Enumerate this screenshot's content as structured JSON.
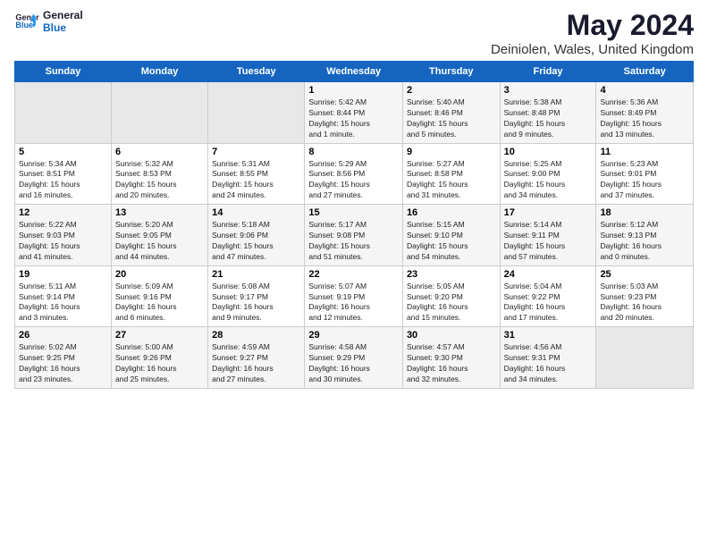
{
  "logo": {
    "line1": "General",
    "line2": "Blue"
  },
  "title": "May 2024",
  "subtitle": "Deiniolen, Wales, United Kingdom",
  "days_of_week": [
    "Sunday",
    "Monday",
    "Tuesday",
    "Wednesday",
    "Thursday",
    "Friday",
    "Saturday"
  ],
  "weeks": [
    [
      {
        "day": "",
        "info": ""
      },
      {
        "day": "",
        "info": ""
      },
      {
        "day": "",
        "info": ""
      },
      {
        "day": "1",
        "info": "Sunrise: 5:42 AM\nSunset: 8:44 PM\nDaylight: 15 hours\nand 1 minute."
      },
      {
        "day": "2",
        "info": "Sunrise: 5:40 AM\nSunset: 8:46 PM\nDaylight: 15 hours\nand 5 minutes."
      },
      {
        "day": "3",
        "info": "Sunrise: 5:38 AM\nSunset: 8:48 PM\nDaylight: 15 hours\nand 9 minutes."
      },
      {
        "day": "4",
        "info": "Sunrise: 5:36 AM\nSunset: 8:49 PM\nDaylight: 15 hours\nand 13 minutes."
      }
    ],
    [
      {
        "day": "5",
        "info": "Sunrise: 5:34 AM\nSunset: 8:51 PM\nDaylight: 15 hours\nand 16 minutes."
      },
      {
        "day": "6",
        "info": "Sunrise: 5:32 AM\nSunset: 8:53 PM\nDaylight: 15 hours\nand 20 minutes."
      },
      {
        "day": "7",
        "info": "Sunrise: 5:31 AM\nSunset: 8:55 PM\nDaylight: 15 hours\nand 24 minutes."
      },
      {
        "day": "8",
        "info": "Sunrise: 5:29 AM\nSunset: 8:56 PM\nDaylight: 15 hours\nand 27 minutes."
      },
      {
        "day": "9",
        "info": "Sunrise: 5:27 AM\nSunset: 8:58 PM\nDaylight: 15 hours\nand 31 minutes."
      },
      {
        "day": "10",
        "info": "Sunrise: 5:25 AM\nSunset: 9:00 PM\nDaylight: 15 hours\nand 34 minutes."
      },
      {
        "day": "11",
        "info": "Sunrise: 5:23 AM\nSunset: 9:01 PM\nDaylight: 15 hours\nand 37 minutes."
      }
    ],
    [
      {
        "day": "12",
        "info": "Sunrise: 5:22 AM\nSunset: 9:03 PM\nDaylight: 15 hours\nand 41 minutes."
      },
      {
        "day": "13",
        "info": "Sunrise: 5:20 AM\nSunset: 9:05 PM\nDaylight: 15 hours\nand 44 minutes."
      },
      {
        "day": "14",
        "info": "Sunrise: 5:18 AM\nSunset: 9:06 PM\nDaylight: 15 hours\nand 47 minutes."
      },
      {
        "day": "15",
        "info": "Sunrise: 5:17 AM\nSunset: 9:08 PM\nDaylight: 15 hours\nand 51 minutes."
      },
      {
        "day": "16",
        "info": "Sunrise: 5:15 AM\nSunset: 9:10 PM\nDaylight: 15 hours\nand 54 minutes."
      },
      {
        "day": "17",
        "info": "Sunrise: 5:14 AM\nSunset: 9:11 PM\nDaylight: 15 hours\nand 57 minutes."
      },
      {
        "day": "18",
        "info": "Sunrise: 5:12 AM\nSunset: 9:13 PM\nDaylight: 16 hours\nand 0 minutes."
      }
    ],
    [
      {
        "day": "19",
        "info": "Sunrise: 5:11 AM\nSunset: 9:14 PM\nDaylight: 16 hours\nand 3 minutes."
      },
      {
        "day": "20",
        "info": "Sunrise: 5:09 AM\nSunset: 9:16 PM\nDaylight: 16 hours\nand 6 minutes."
      },
      {
        "day": "21",
        "info": "Sunrise: 5:08 AM\nSunset: 9:17 PM\nDaylight: 16 hours\nand 9 minutes."
      },
      {
        "day": "22",
        "info": "Sunrise: 5:07 AM\nSunset: 9:19 PM\nDaylight: 16 hours\nand 12 minutes."
      },
      {
        "day": "23",
        "info": "Sunrise: 5:05 AM\nSunset: 9:20 PM\nDaylight: 16 hours\nand 15 minutes."
      },
      {
        "day": "24",
        "info": "Sunrise: 5:04 AM\nSunset: 9:22 PM\nDaylight: 16 hours\nand 17 minutes."
      },
      {
        "day": "25",
        "info": "Sunrise: 5:03 AM\nSunset: 9:23 PM\nDaylight: 16 hours\nand 20 minutes."
      }
    ],
    [
      {
        "day": "26",
        "info": "Sunrise: 5:02 AM\nSunset: 9:25 PM\nDaylight: 16 hours\nand 23 minutes."
      },
      {
        "day": "27",
        "info": "Sunrise: 5:00 AM\nSunset: 9:26 PM\nDaylight: 16 hours\nand 25 minutes."
      },
      {
        "day": "28",
        "info": "Sunrise: 4:59 AM\nSunset: 9:27 PM\nDaylight: 16 hours\nand 27 minutes."
      },
      {
        "day": "29",
        "info": "Sunrise: 4:58 AM\nSunset: 9:29 PM\nDaylight: 16 hours\nand 30 minutes."
      },
      {
        "day": "30",
        "info": "Sunrise: 4:57 AM\nSunset: 9:30 PM\nDaylight: 16 hours\nand 32 minutes."
      },
      {
        "day": "31",
        "info": "Sunrise: 4:56 AM\nSunset: 9:31 PM\nDaylight: 16 hours\nand 34 minutes."
      },
      {
        "day": "",
        "info": ""
      }
    ]
  ]
}
